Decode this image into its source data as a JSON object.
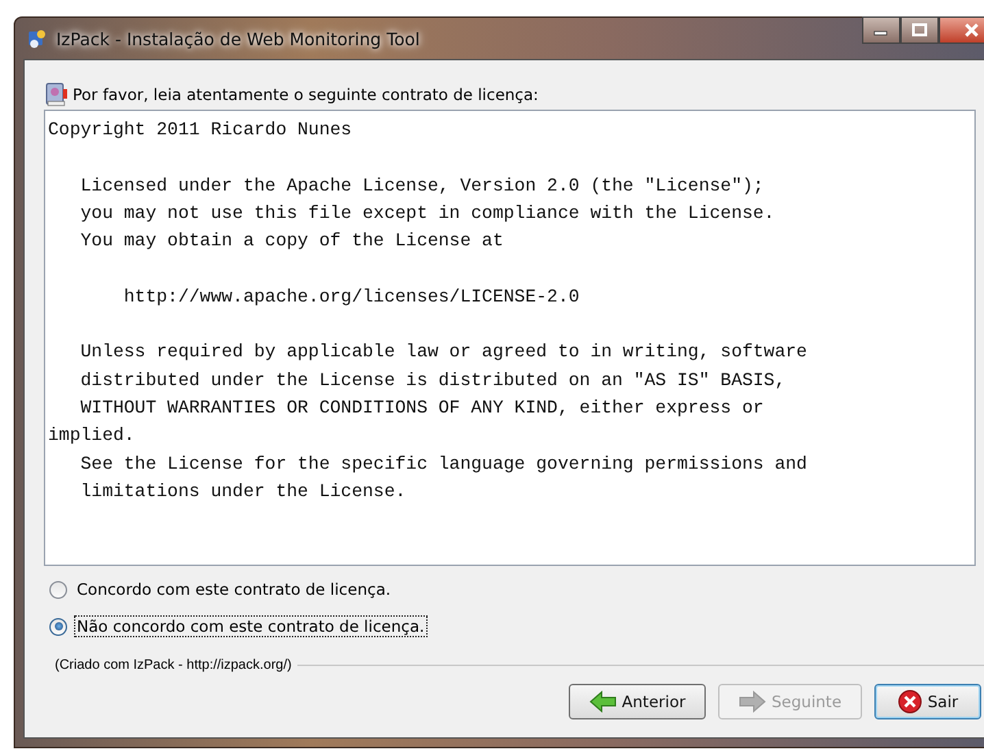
{
  "window": {
    "title": "IzPack - Instalação de Web Monitoring Tool"
  },
  "prompt": "Por favor, leia atentamente o seguinte contrato de licença:",
  "license_text": "Copyright 2011 Ricardo Nunes\n\n   Licensed under the Apache License, Version 2.0 (the \"License\");\n   you may not use this file except in compliance with the License.\n   You may obtain a copy of the License at\n\n       http://www.apache.org/licenses/LICENSE-2.0\n\n   Unless required by applicable law or agreed to in writing, software\n   distributed under the License is distributed on an \"AS IS\" BASIS,\n   WITHOUT WARRANTIES OR CONDITIONS OF ANY KIND, either express or\nimplied.\n   See the License for the specific language governing permissions and\n   limitations under the License.",
  "options": [
    {
      "label": "Concordo com este contrato de licença.",
      "selected": false
    },
    {
      "label": "Não concordo com este contrato de licença.",
      "selected": true
    }
  ],
  "credit": "(Criado com IzPack - http://izpack.org/)",
  "buttons": [
    {
      "label": "Anterior",
      "kind": "back",
      "disabled": false
    },
    {
      "label": "Seguinte",
      "kind": "next",
      "disabled": true
    },
    {
      "label": "Sair",
      "kind": "quit",
      "disabled": false
    }
  ]
}
